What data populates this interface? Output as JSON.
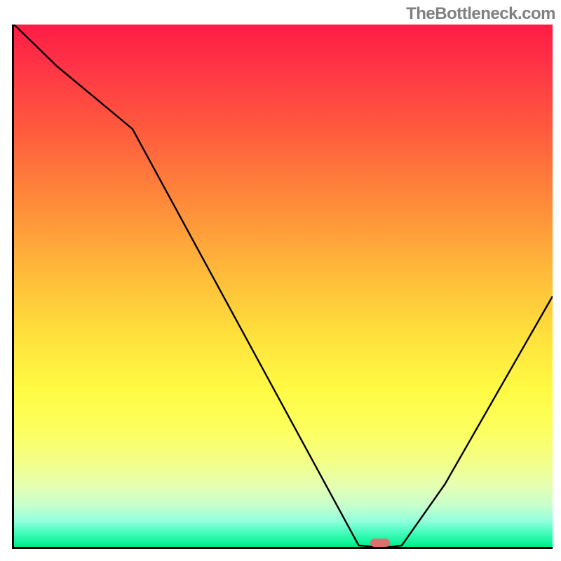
{
  "watermark": "TheBottleneck.com",
  "chart_data": {
    "type": "line",
    "x": [
      0,
      8,
      22,
      64,
      67,
      70,
      72,
      80,
      100
    ],
    "values": [
      100,
      92,
      80,
      0.3,
      0.0,
      0.0,
      0.3,
      12,
      48
    ],
    "title": "",
    "xlabel": "",
    "ylabel": "",
    "xlim": [
      0,
      100
    ],
    "ylim": [
      0,
      100
    ],
    "marker": {
      "x": 68,
      "y": 0.8
    },
    "colors": {
      "gradient_top": "#ff1c44",
      "gradient_mid": "#ffe23c",
      "gradient_bottom": "#00e884",
      "curve": "#000000",
      "marker": "#e26f6f",
      "watermark": "#808080"
    }
  }
}
